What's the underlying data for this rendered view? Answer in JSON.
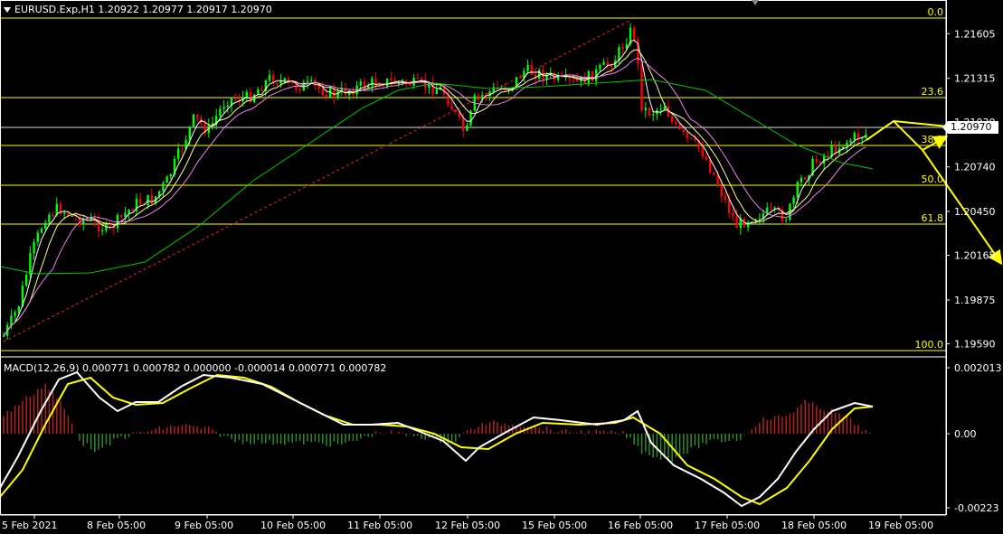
{
  "window": {
    "title": "EURUSD.Exp,H1  1.20922 1.20977 1.20917 1.20970",
    "current_price": "1.20970"
  },
  "indicator": {
    "label": "MACD(12,26,9) 0.000771 0.000782 0.000000 -0.000014 0.000771 0.000782"
  },
  "chart_data": {
    "type": "candlestick",
    "symbol": "EURUSD.Exp",
    "timeframe": "H1",
    "ohlc": {
      "open": 1.20922,
      "high": 1.20977,
      "low": 1.20917,
      "close": 1.2097
    },
    "price_ticks": [
      "1.21605",
      "1.21315",
      "1.21030",
      "1.20740",
      "1.20450",
      "1.20165",
      "1.19875",
      "1.19590"
    ],
    "time_ticks": [
      "5 Feb 2021",
      "8 Feb 05:00",
      "9 Feb 05:00",
      "10 Feb 05:00",
      "11 Feb 05:00",
      "12 Feb 05:00",
      "15 Feb 05:00",
      "16 Feb 05:00",
      "17 Feb 05:00",
      "18 Feb 05:00",
      "19 Feb 05:00"
    ],
    "fibonacci_levels": [
      "0.0",
      "23.6",
      "38.2",
      "50.0",
      "61.8",
      "100.0"
    ],
    "macd": {
      "ticks": [
        "0.002013",
        "0.00",
        "-0.00223"
      ],
      "params": "12,26,9"
    },
    "colors": {
      "bull": "#00ff00",
      "bear": "#ff0000",
      "fib": "#ffff00",
      "ma_fast": "#ffffff",
      "ma_mid": "#ffff99",
      "ma_slow": "#ee82ee",
      "ma_long": "#00c800",
      "trend": "#ff2020",
      "forecast": "#ffff00",
      "hist_up": "#b22222",
      "hist_down": "#2e8b2e"
    }
  }
}
